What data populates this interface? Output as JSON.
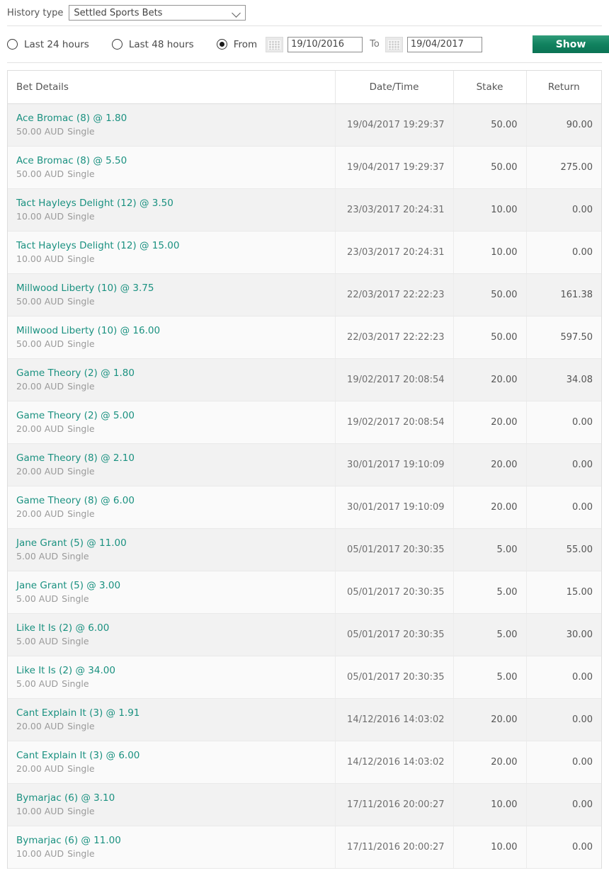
{
  "history": {
    "label": "History type",
    "selected": "Settled Sports Bets",
    "chevron_icon": "chevron-down-icon"
  },
  "filters": {
    "last24_label": "Last 24 hours",
    "last48_label": "Last 48 hours",
    "from_label": "From",
    "to_label": "To",
    "from_date": "19/10/2016",
    "to_date": "19/04/2017",
    "selected_option": "From",
    "calendar_icon": "calendar-icon",
    "show_label": "Show",
    "accent_color": "#11825f"
  },
  "table": {
    "columns": [
      "Bet Details",
      "Date/Time",
      "Stake",
      "Return"
    ],
    "link_color": "#1a9180",
    "rows": [
      {
        "title": "Ace Bromac (8) @ 1.80",
        "amount": "50.00 AUD",
        "type": "Single",
        "datetime": "19/04/2017 19:29:37",
        "stake": "50.00",
        "return": "90.00"
      },
      {
        "title": "Ace Bromac (8) @ 5.50",
        "amount": "50.00 AUD",
        "type": "Single",
        "datetime": "19/04/2017 19:29:37",
        "stake": "50.00",
        "return": "275.00"
      },
      {
        "title": "Tact Hayleys Delight (12) @ 3.50",
        "amount": "10.00 AUD",
        "type": "Single",
        "datetime": "23/03/2017 20:24:31",
        "stake": "10.00",
        "return": "0.00"
      },
      {
        "title": "Tact Hayleys Delight (12) @ 15.00",
        "amount": "10.00 AUD",
        "type": "Single",
        "datetime": "23/03/2017 20:24:31",
        "stake": "10.00",
        "return": "0.00"
      },
      {
        "title": "Millwood Liberty (10) @ 3.75",
        "amount": "50.00 AUD",
        "type": "Single",
        "datetime": "22/03/2017 22:22:23",
        "stake": "50.00",
        "return": "161.38"
      },
      {
        "title": "Millwood Liberty (10) @ 16.00",
        "amount": "50.00 AUD",
        "type": "Single",
        "datetime": "22/03/2017 22:22:23",
        "stake": "50.00",
        "return": "597.50"
      },
      {
        "title": "Game Theory (2) @ 1.80",
        "amount": "20.00 AUD",
        "type": "Single",
        "datetime": "19/02/2017 20:08:54",
        "stake": "20.00",
        "return": "34.08"
      },
      {
        "title": "Game Theory (2) @ 5.00",
        "amount": "20.00 AUD",
        "type": "Single",
        "datetime": "19/02/2017 20:08:54",
        "stake": "20.00",
        "return": "0.00"
      },
      {
        "title": "Game Theory (8) @ 2.10",
        "amount": "20.00 AUD",
        "type": "Single",
        "datetime": "30/01/2017 19:10:09",
        "stake": "20.00",
        "return": "0.00"
      },
      {
        "title": "Game Theory (8) @ 6.00",
        "amount": "20.00 AUD",
        "type": "Single",
        "datetime": "30/01/2017 19:10:09",
        "stake": "20.00",
        "return": "0.00"
      },
      {
        "title": "Jane Grant (5) @ 11.00",
        "amount": "5.00 AUD",
        "type": "Single",
        "datetime": "05/01/2017 20:30:35",
        "stake": "5.00",
        "return": "55.00"
      },
      {
        "title": "Jane Grant (5) @ 3.00",
        "amount": "5.00 AUD",
        "type": "Single",
        "datetime": "05/01/2017 20:30:35",
        "stake": "5.00",
        "return": "15.00"
      },
      {
        "title": "Like It Is (2) @ 6.00",
        "amount": "5.00 AUD",
        "type": "Single",
        "datetime": "05/01/2017 20:30:35",
        "stake": "5.00",
        "return": "30.00"
      },
      {
        "title": "Like It Is (2) @ 34.00",
        "amount": "5.00 AUD",
        "type": "Single",
        "datetime": "05/01/2017 20:30:35",
        "stake": "5.00",
        "return": "0.00"
      },
      {
        "title": "Cant Explain It (3) @ 1.91",
        "amount": "20.00 AUD",
        "type": "Single",
        "datetime": "14/12/2016 14:03:02",
        "stake": "20.00",
        "return": "0.00"
      },
      {
        "title": "Cant Explain It (3) @ 6.00",
        "amount": "20.00 AUD",
        "type": "Single",
        "datetime": "14/12/2016 14:03:02",
        "stake": "20.00",
        "return": "0.00"
      },
      {
        "title": "Bymarjac (6) @ 3.10",
        "amount": "10.00 AUD",
        "type": "Single",
        "datetime": "17/11/2016 20:00:27",
        "stake": "10.00",
        "return": "0.00"
      },
      {
        "title": "Bymarjac (6) @ 11.00",
        "amount": "10.00 AUD",
        "type": "Single",
        "datetime": "17/11/2016 20:00:27",
        "stake": "10.00",
        "return": "0.00"
      }
    ]
  }
}
